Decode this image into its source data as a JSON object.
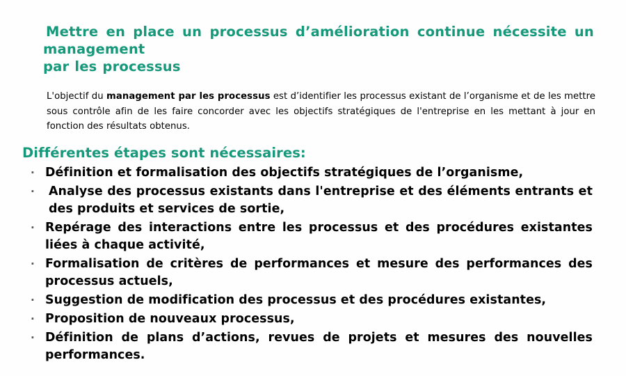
{
  "theme": {
    "background": "#fefefe",
    "accent_teal": "#16987a",
    "body_text": "#000000",
    "bullet_marker": "#555555"
  },
  "slide": {
    "title_line_1": "Mettre en place un processus d’amélioration continue nécessite un management",
    "title_line_2": "par les processus",
    "intro": {
      "part_1": "L'objectif du ",
      "emphasis": "management par les processus",
      "part_2": " est d’identifier les processus existant de l’organisme et de les mettre sous contrôle afin de les faire concorder avec les objectifs stratégiques de l'entreprise en les mettant à jour en fonction des résultats obtenus."
    },
    "section_heading": "Différentes  étapes sont nécessaires:",
    "bullet_glyph": "·",
    "steps": [
      {
        "text": "Définition et formalisation des objectifs stratégiques de l’organisme,",
        "wraps": false
      },
      {
        "text": "Analyse des processus existants dans l'entreprise et des éléments entrants et des produits et services de sortie,",
        "wraps": true
      },
      {
        "text": "Repérage des interactions entre les processus et des procédures existantes liées à chaque activité,",
        "wraps": true
      },
      {
        "text": "Formalisation de critères de performances et mesure des performances des processus actuels,",
        "wraps": true
      },
      {
        "text": "Suggestion de modification des processus et des procédures existantes,",
        "wraps": false
      },
      {
        "text": "Proposition de nouveaux processus,",
        "wraps": false
      },
      {
        "text": "Définition de plans d’actions, revues de projets et mesures des nouvelles performances.",
        "wraps": true
      }
    ]
  }
}
